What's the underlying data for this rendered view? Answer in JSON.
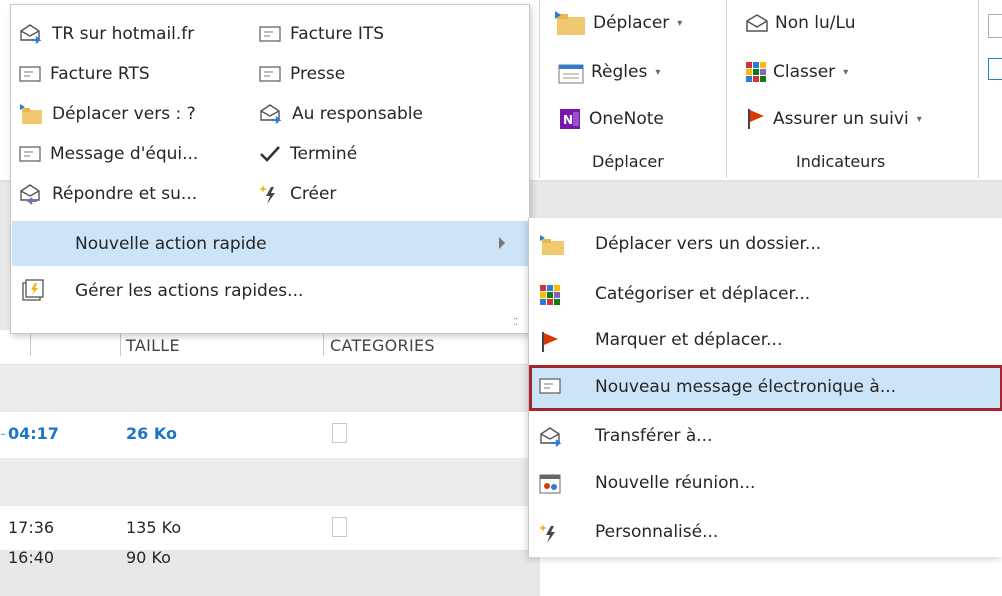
{
  "ribbon": {
    "deplacer_group": {
      "move_button": "Déplacer",
      "rules_button": "Règles",
      "onenote_button": "OneNote",
      "group_label": "Déplacer"
    },
    "indicateurs_group": {
      "read_unread_button": "Non lu/Lu",
      "categorize_button": "Classer",
      "follow_up_button": "Assurer un suivi",
      "group_label": "Indicateurs"
    },
    "dropdown_arrow": "▾"
  },
  "quick_steps_menu": {
    "items": [
      {
        "label": "TR sur hotmail.fr",
        "icon": "forward-envelope-icon"
      },
      {
        "label": "Facture ITS",
        "icon": "email-form-icon"
      },
      {
        "label": "Facture RTS",
        "icon": "email-form-icon"
      },
      {
        "label": "Presse",
        "icon": "email-form-icon"
      },
      {
        "label": "Déplacer vers : ?",
        "icon": "folder-move-icon"
      },
      {
        "label": "Au responsable",
        "icon": "forward-envelope-icon"
      },
      {
        "label": "Message d'équi...",
        "icon": "email-form-icon"
      },
      {
        "label": "Terminé",
        "icon": "checkmark-icon"
      },
      {
        "label": "Répondre et su...",
        "icon": "reply-delete-icon"
      },
      {
        "label": "Créer",
        "icon": "lightning-spark-icon"
      }
    ],
    "new_quick_step": "Nouvelle action rapide",
    "manage_quick_steps": "Gérer les actions rapides..."
  },
  "submenu": {
    "items": [
      {
        "label": "Déplacer vers un dossier...",
        "icon": "folder-move-icon"
      },
      {
        "label": "Catégoriser et déplacer...",
        "icon": "category-grid-icon"
      },
      {
        "label": "Marquer et déplacer...",
        "icon": "flag-icon"
      },
      {
        "label": "Nouveau message électronique à...",
        "icon": "email-form-icon"
      },
      {
        "label": "Transférer à...",
        "icon": "forward-envelope-icon"
      },
      {
        "label": "Nouvelle réunion...",
        "icon": "meeting-calendar-icon"
      },
      {
        "label": "Personnalisé...",
        "icon": "lightning-spark-icon"
      }
    ],
    "highlighted_index": 3
  },
  "message_list": {
    "columns": {
      "taille": "TAILLE",
      "categories": "CATEGORIES"
    },
    "rows": [
      {
        "time": "04:17",
        "size": "26 Ko",
        "time_prefix": "-"
      },
      {
        "time": "17:36",
        "size": "135 Ko",
        "time_prefix": ""
      },
      {
        "time": "16:40",
        "size": "90 Ko",
        "time_prefix": ""
      }
    ]
  },
  "colors": {
    "hover_blue": "#cce4f7",
    "highlight_border": "#a4262c",
    "link_blue": "#1e74c8",
    "flag_red": "#d83b01"
  }
}
